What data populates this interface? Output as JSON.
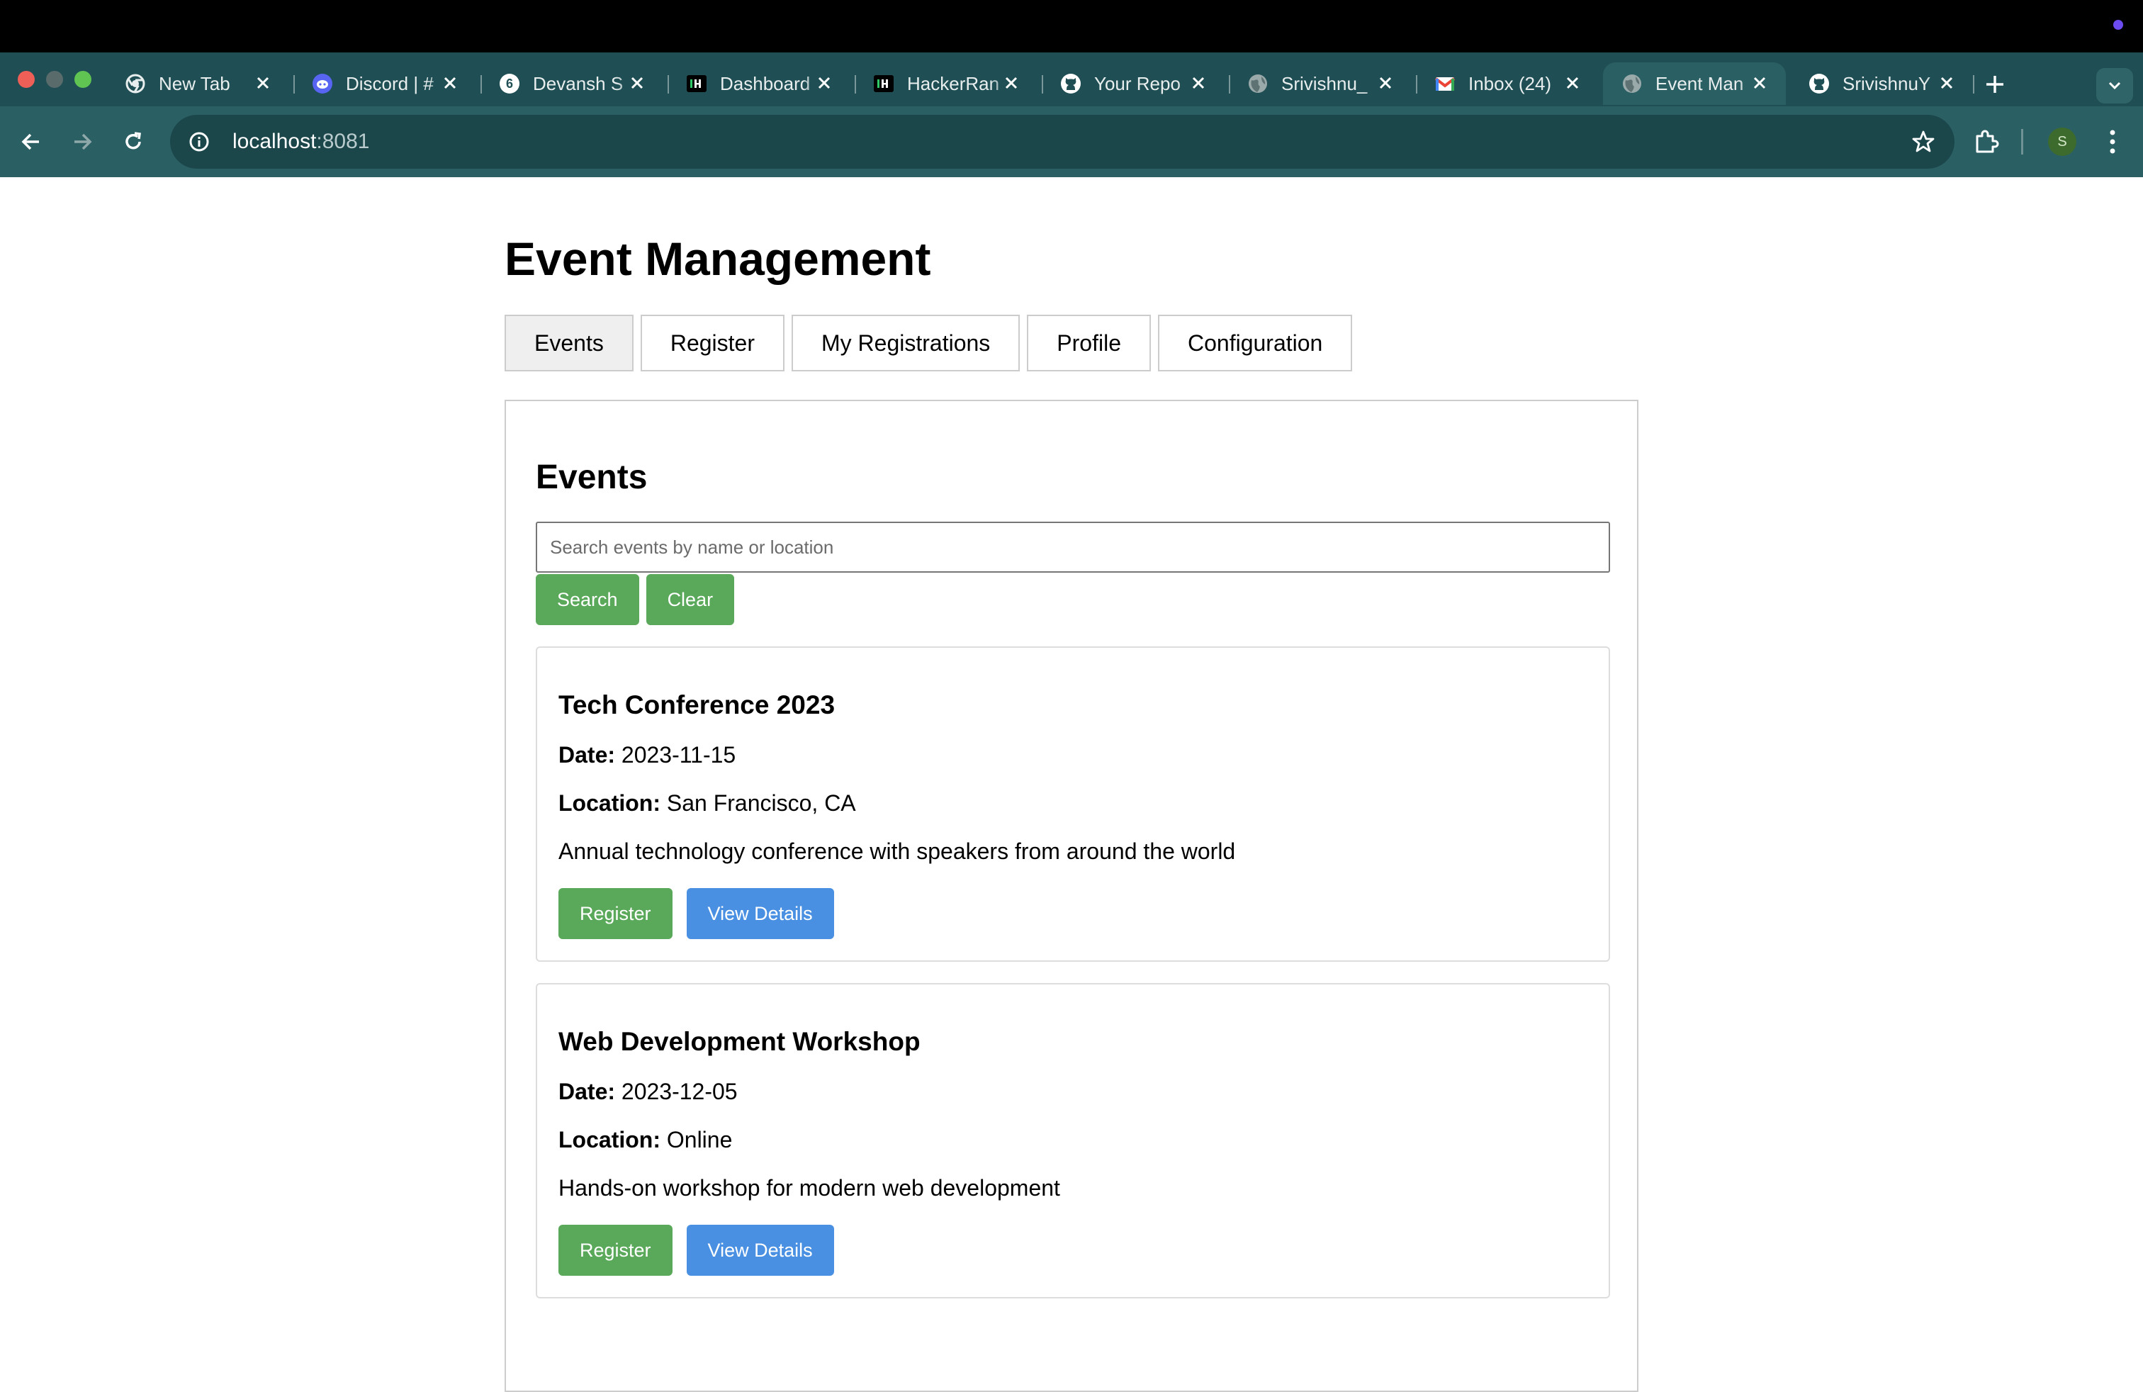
{
  "browser": {
    "tabs": [
      {
        "title": "New Tab",
        "icon": "chrome-icon"
      },
      {
        "title": "Discord | #",
        "icon": "discord-icon"
      },
      {
        "title": "Devansh S",
        "icon": "devansh-icon"
      },
      {
        "title": "Dashboard",
        "icon": "hackerrank-icon"
      },
      {
        "title": "HackerRan",
        "icon": "hackerrank-icon"
      },
      {
        "title": "Your Repo",
        "icon": "github-icon"
      },
      {
        "title": "Srivishnu_",
        "icon": "globe-icon"
      },
      {
        "title": "Inbox (24)",
        "icon": "gmail-icon"
      },
      {
        "title": "Event Man",
        "icon": "globe-icon"
      },
      {
        "title": "SrivishnuY",
        "icon": "github-icon"
      }
    ],
    "active_tab_index": 8,
    "url_host": "localhost",
    "url_port": ":8081",
    "profile_initial": "S",
    "colors": {
      "frame": "#1f4f54",
      "toolbar": "#2a5f64",
      "omnibox": "#1b474b"
    }
  },
  "app": {
    "title": "Event Management",
    "nav_tabs": [
      {
        "label": "Events"
      },
      {
        "label": "Register"
      },
      {
        "label": "My Registrations"
      },
      {
        "label": "Profile"
      },
      {
        "label": "Configuration"
      }
    ],
    "active_nav": "Events"
  },
  "events_section": {
    "title": "Events",
    "search_placeholder": "Search events by name or location",
    "search_value": "",
    "search_label": "Search",
    "clear_label": "Clear",
    "date_label": "Date:",
    "location_label": "Location:",
    "register_label": "Register",
    "details_label": "View Details",
    "events": [
      {
        "name": "Tech Conference 2023",
        "date": "2023-11-15",
        "location": "San Francisco, CA",
        "description": "Annual technology conference with speakers from around the world"
      },
      {
        "name": "Web Development Workshop",
        "date": "2023-12-05",
        "location": "Online",
        "description": "Hands-on workshop for modern web development"
      }
    ],
    "colors": {
      "green_button": "#5aa85a",
      "blue_button": "#4a90e2"
    }
  }
}
